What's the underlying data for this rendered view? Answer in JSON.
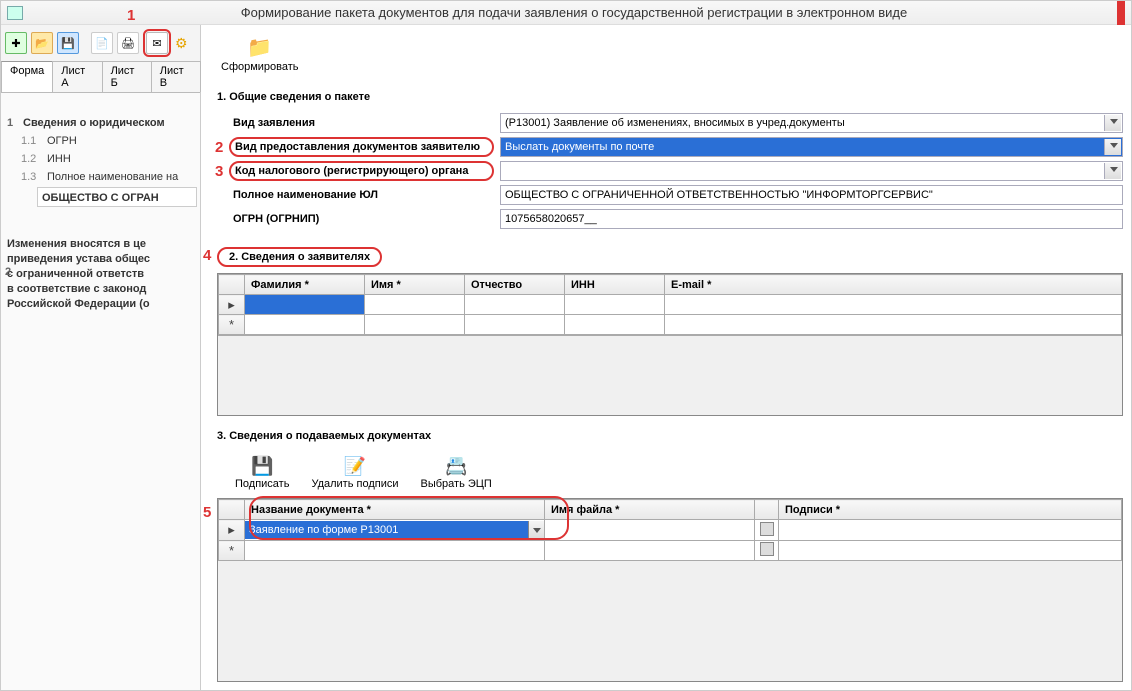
{
  "title": "Формирование пакета документов для подачи заявления о государственной регистрации в электронном виде",
  "callouts": {
    "c1": "1",
    "c2": "2",
    "c3": "3",
    "c4": "4",
    "c5": "5"
  },
  "left": {
    "tabs": {
      "forma": "Форма",
      "listA": "Лист А",
      "listB": "Лист Б",
      "listV": "Лист В"
    },
    "tree": {
      "n1": "1",
      "t1": "Сведения о юридическом",
      "n11": "1.1",
      "t11": "ОГРН",
      "n12": "1.2",
      "t12": "ИНН",
      "n13": "1.3",
      "t13": "Полное наименование на",
      "fullname": "ОБЩЕСТВО  С  ОГРАН",
      "n2": "2",
      "para": "Изменения вносятся в це\nприведения устава общес\nс ограниченной ответств\nв соответствие с законод\nРоссийской Федерации (о"
    }
  },
  "form": {
    "btn_form": "Сформировать",
    "sec1_title": "1. Общие сведения о пакете",
    "f_vid_label": "Вид заявления",
    "f_vid_value": "(Р13001) Заявление об изменениях, вносимых в учред.документы",
    "f_pred_label": "Вид предоставления документов заявителю",
    "f_pred_value": "Выслать документы по почте",
    "f_kod_label": "Код налогового (регистрирующего) органа",
    "f_kod_value": "",
    "f_full_label": "Полное наименование ЮЛ",
    "f_full_value": "ОБЩЕСТВО С ОГРАНИЧЕННОЙ ОТВЕТСТВЕННОСТЬЮ \"ИНФОРМТОРГСЕРВИС\"",
    "f_ogrn_label": "ОГРН (ОГРНИП)",
    "f_ogrn_value": "1075658020657__",
    "sec2_title": "2. Сведения о заявителях",
    "grid1": {
      "fam": "Фамилия *",
      "imya": "Имя *",
      "otch": "Отчество",
      "inn": "ИНН",
      "email": "E-mail *"
    },
    "sec3_title": "3. Сведения о подаваемых документах",
    "tb": {
      "sign": "Подписать",
      "unsign": "Удалить подписи",
      "pick": "Выбрать ЭЦП"
    },
    "grid2": {
      "doc": "Название документа *",
      "file": "Имя файла *",
      "sig": "Подписи *",
      "row1": "Заявление по форме Р13001"
    }
  }
}
